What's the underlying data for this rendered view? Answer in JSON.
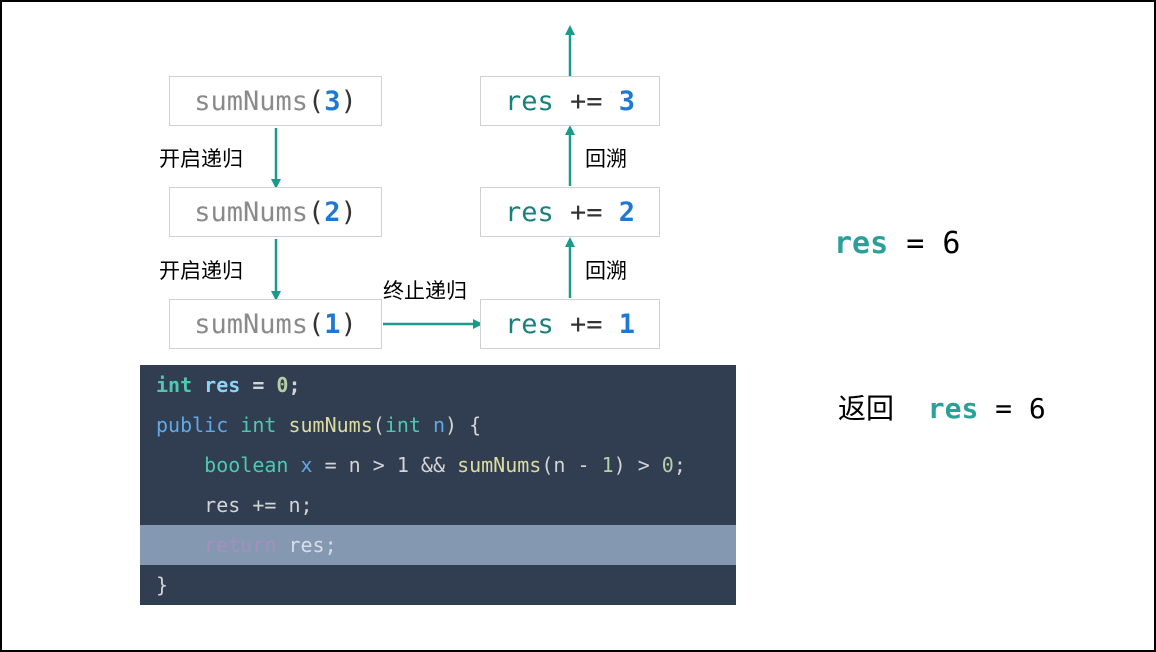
{
  "calls": [
    {
      "fn": "sumNums",
      "open": "(",
      "arg": "3",
      "close": ")"
    },
    {
      "fn": "sumNums",
      "open": "(",
      "arg": "2",
      "close": ")"
    },
    {
      "fn": "sumNums",
      "open": "(",
      "arg": "1",
      "close": ")"
    }
  ],
  "results": [
    {
      "kw": "res",
      "op": " += ",
      "val": "3"
    },
    {
      "kw": "res",
      "op": " += ",
      "val": "2"
    },
    {
      "kw": "res",
      "op": " += ",
      "val": "1"
    }
  ],
  "labels": {
    "recurse_1": "开启递归",
    "recurse_2": "开启递归",
    "terminate": "终止递归",
    "backtrack_1": "回溯",
    "backtrack_2": "回溯"
  },
  "code": {
    "line1": {
      "type": "int",
      "var": "res",
      "eq": " = ",
      "num": "0",
      "semi": ";"
    },
    "line2": {
      "pub": "public",
      "type": "int",
      "fn": "sumNums",
      "open": "(",
      "ptype": "int",
      "param": "n",
      "rest": ") {"
    },
    "line3": {
      "indent": "    ",
      "type": "boolean",
      "var": "x",
      "mid": " = n > 1 && ",
      "fn": "sumNums",
      "args": "(n - ",
      "num1": "1",
      "tail": ") > ",
      "num2": "0",
      "semi": ";"
    },
    "line4": {
      "indent": "    ",
      "text": "res += n;"
    },
    "line5": {
      "indent": "    ",
      "kw": "return",
      "rest": " res;"
    },
    "line6": {
      "text": "}"
    }
  },
  "result_main": {
    "kw": "res",
    "eq": " = ",
    "val": "6"
  },
  "result_return": {
    "prefix": "返回",
    "kw": "res",
    "eq": " = ",
    "val": "6"
  },
  "colors": {
    "arrow": "#1a9a8a",
    "code_bg": "#313d50",
    "highlight": "#8499b1",
    "number": "#1f78d1"
  }
}
